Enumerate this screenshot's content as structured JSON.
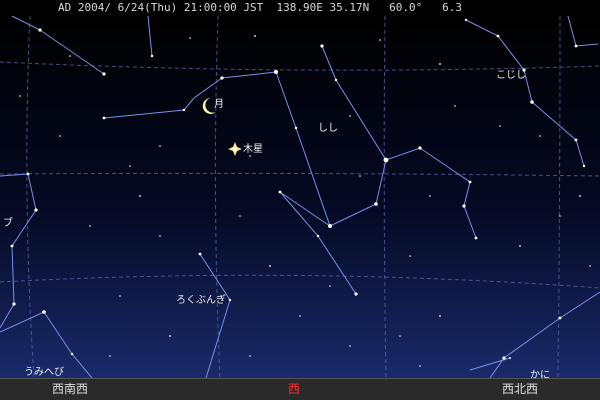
{
  "header": {
    "info_line": "AD 2004/ 6/24(Thu) 21:00:00 JST  138.90E 35.17N   60.0°   6.3"
  },
  "labels": {
    "moon": "月",
    "jupiter": "木星",
    "leo": "しし",
    "ursa_minor": "こじし",
    "sextans": "ろくぶんぎ",
    "hydra": "うみへび",
    "cancer": "かに",
    "partial_left": "ブ"
  },
  "directions": {
    "left": "西南西",
    "center": "西",
    "right": "西北西"
  },
  "colors": {
    "sky_top": "#000000",
    "sky_bottom": "#1a2a6a",
    "grid": "#5a6aa8",
    "constellation": "#7a90e8",
    "jupiter": "#ffe680",
    "moon": "#fff3b0",
    "center_direction": "#ff3030"
  }
}
